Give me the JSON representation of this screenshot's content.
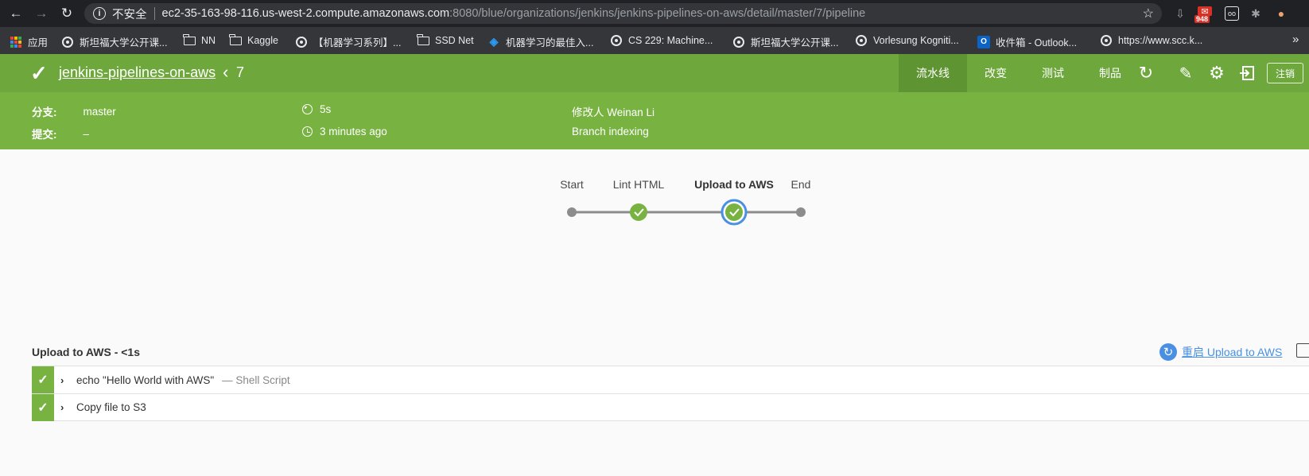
{
  "browser": {
    "insecure_label": "不安全",
    "url_host": "ec2-35-163-98-116.us-west-2.compute.amazonaws.com",
    "url_path": ":8080/blue/organizations/jenkins/jenkins-pipelines-on-aws/detail/master/7/pipeline",
    "badge_count": "948",
    "bookmarks": [
      {
        "label": "应用",
        "icon": "apps-icon"
      },
      {
        "label": "斯坦福大学公开课...",
        "icon": "globe-icon"
      },
      {
        "label": "NN",
        "icon": "folder-icon"
      },
      {
        "label": "Kaggle",
        "icon": "folder-icon"
      },
      {
        "label": "【机器学习系列】...",
        "icon": "globe-icon"
      },
      {
        "label": "SSD Net",
        "icon": "folder-icon"
      },
      {
        "label": "机器学习的最佳入...",
        "icon": "blue-logo-icon"
      },
      {
        "label": "CS 229: Machine...",
        "icon": "globe-icon"
      },
      {
        "label": "斯坦福大学公开课...",
        "icon": "globe-icon"
      },
      {
        "label": "Vorlesung Kogniti...",
        "icon": "globe-icon"
      },
      {
        "label": "收件箱 - Outlook...",
        "icon": "outlook-icon"
      },
      {
        "label": "https://www.scc.k...",
        "icon": "globe-icon"
      }
    ],
    "more_label": "»"
  },
  "header": {
    "pipeline_name": "jenkins-pipelines-on-aws",
    "back_glyph": "‹",
    "run_number": "7",
    "tabs": [
      "流水线",
      "改变",
      "测试",
      "制品"
    ],
    "logout_label": "注销"
  },
  "summary": {
    "branch_label": "分支:",
    "branch_value": "master",
    "commit_label": "提交:",
    "commit_value": "–",
    "duration": "5s",
    "time_ago": "3 minutes ago",
    "changes_by": "修改人 Weinan Li",
    "cause": "Branch indexing"
  },
  "graph": {
    "stages": [
      {
        "label": "Start",
        "kind": "endpoint"
      },
      {
        "label": "Lint HTML",
        "kind": "success"
      },
      {
        "label": "Upload to AWS",
        "kind": "success-selected"
      },
      {
        "label": "End",
        "kind": "endpoint"
      }
    ]
  },
  "detail": {
    "title": "Upload to AWS - <1s",
    "restart_label": "重启 Upload to AWS",
    "steps": [
      {
        "text": "echo \"Hello World with AWS\"",
        "desc": "— Shell Script"
      },
      {
        "text": "Copy file to S3",
        "desc": ""
      }
    ]
  },
  "colors": {
    "header_green": "#6ea83d",
    "sub_green": "#78b341",
    "success": "#78b341",
    "selected_ring": "#4a90e2",
    "connector": "#8c8c8c"
  }
}
